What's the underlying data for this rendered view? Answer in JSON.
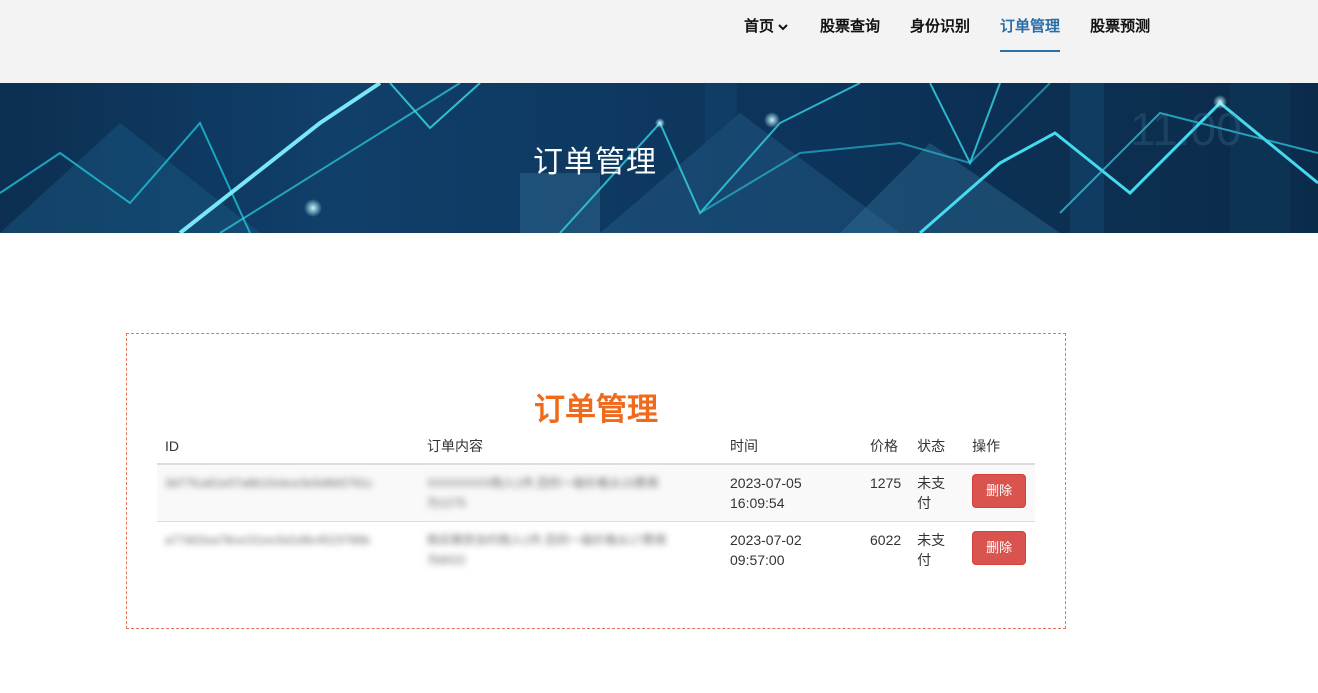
{
  "nav": {
    "items": [
      {
        "label": "首页",
        "has_dropdown": true,
        "active": false
      },
      {
        "label": "股票查询",
        "active": false
      },
      {
        "label": "身份识别",
        "active": false
      },
      {
        "label": "订单管理",
        "active": true
      },
      {
        "label": "股票预测",
        "active": false
      }
    ]
  },
  "banner": {
    "title": "订单管理"
  },
  "orders": {
    "title": "订单管理",
    "columns": [
      "ID",
      "订单内容",
      "时间",
      "价格",
      "状态",
      "操作"
    ],
    "rows": [
      {
        "id": "3d77fca61e07a8b10cbce3e5d6b5791c",
        "content_line1": "XXXXXXXX购入1件,您的一级价格从15费用",
        "content_line2": "为1275",
        "time_date": "2023-07-05",
        "time_clock": "16:09:54",
        "price": "1275",
        "status": "未支付",
        "action_label": "删除"
      },
      {
        "id": "a77d02ea78ce151ec5d1d9c4523786b",
        "content_line1": "购买期货合约购入1件,您的一级价格从17费用",
        "content_line2": "为6022",
        "time_date": "2023-07-02",
        "time_clock": "09:57:00",
        "price": "6022",
        "status": "未支付",
        "action_label": "删除"
      }
    ]
  },
  "colors": {
    "nav_bg": "#f3f3f3",
    "nav_active": "#2a6ea8",
    "card_title": "#f06a1c",
    "card_border": "#e8735a",
    "delete_button": "#d9534f"
  }
}
